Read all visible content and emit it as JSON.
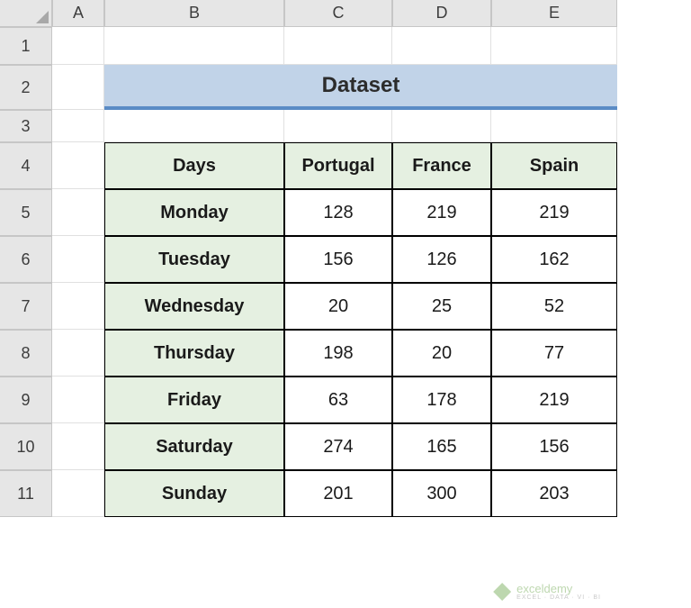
{
  "columns": [
    "A",
    "B",
    "C",
    "D",
    "E"
  ],
  "rows": [
    "1",
    "2",
    "3",
    "4",
    "5",
    "6",
    "7",
    "8",
    "9",
    "10",
    "11"
  ],
  "title": "Dataset",
  "table": {
    "headers": [
      "Days",
      "Portugal",
      "France",
      "Spain"
    ],
    "data": [
      {
        "day": "Monday",
        "portugal": 128,
        "france": 219,
        "spain": 219
      },
      {
        "day": "Tuesday",
        "portugal": 156,
        "france": 126,
        "spain": 162
      },
      {
        "day": "Wednesday",
        "portugal": 20,
        "france": 25,
        "spain": 52
      },
      {
        "day": "Thursday",
        "portugal": 198,
        "france": 20,
        "spain": 77
      },
      {
        "day": "Friday",
        "portugal": 63,
        "france": 178,
        "spain": 219
      },
      {
        "day": "Saturday",
        "portugal": 274,
        "france": 165,
        "spain": 156
      },
      {
        "day": "Sunday",
        "portugal": 201,
        "france": 300,
        "spain": 203
      }
    ]
  },
  "watermark": {
    "brand": "exceldemy",
    "tagline": "EXCEL · DATA · VI · BI"
  }
}
